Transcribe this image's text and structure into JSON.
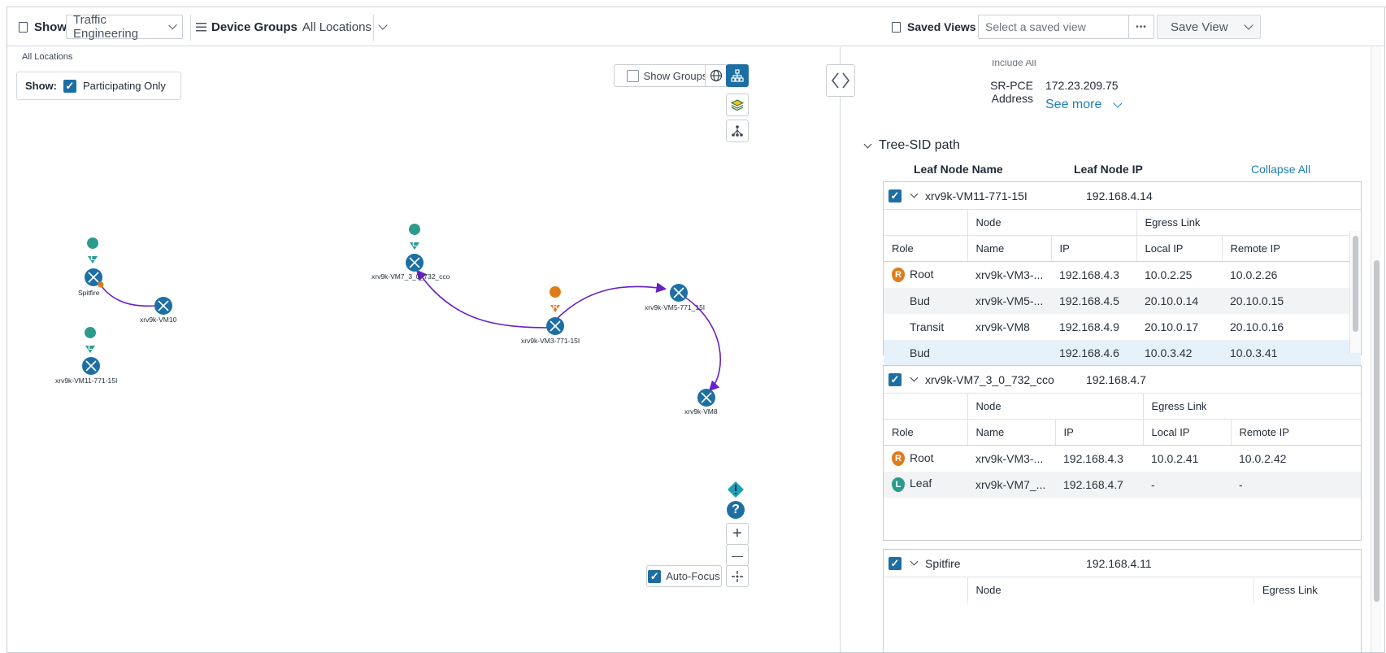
{
  "topbar": {
    "show_label": "Show",
    "show_value": "Traffic Engineering",
    "device_groups_label": "Device Groups",
    "device_groups_value": "All Locations",
    "saved_views_label": "Saved Views",
    "saved_view_placeholder": "Select a saved view",
    "more_label": "•••",
    "save_view_label": "Save View"
  },
  "map": {
    "breadcrumb": "All Locations",
    "show_label": "Show:",
    "participating_label": "Participating Only",
    "show_groups_label": "Show Groups",
    "auto_focus_label": "Auto-Focus",
    "nodes": {
      "spitfire": "Spitfire",
      "vm10": "xrv9k-VM10",
      "vm11": "xrv9k-VM11-771-15I",
      "vm7": "xrv9k-VM7_3_0_732_cco",
      "vm3": "xrv9k-VM3-771-15I",
      "vm5": "xrv9k-VM5-771_15I",
      "vm8": "xrv9k-VM8"
    },
    "badges": {
      "leaf": "L",
      "root": "R"
    },
    "zoom_in": "+",
    "zoom_out": "—",
    "help": "?"
  },
  "details": {
    "cut_text": "Include All",
    "srpce_label": "SR-PCE Address",
    "srpce_value": "172.23.209.75",
    "see_more": "See more",
    "section_title": "Tree-SID path",
    "col_leaf_name": "Leaf Node Name",
    "col_leaf_ip": "Leaf Node IP",
    "collapse_all": "Collapse All",
    "group_node": "Node",
    "group_egress": "Egress Link",
    "col_role": "Role",
    "col_name": "Name",
    "col_ip": "IP",
    "col_local_ip": "Local IP",
    "col_remote_ip": "Remote IP",
    "leaves": [
      {
        "name": "xrv9k-VM11-771-15I",
        "ip": "192.168.4.14",
        "rows": [
          {
            "badge": "R",
            "role": "Root",
            "name": "xrv9k-VM3-...",
            "ip": "192.168.4.3",
            "local": "10.0.2.25",
            "remote": "10.0.2.26"
          },
          {
            "badge": "",
            "role": "Bud",
            "name": "xrv9k-VM5-...",
            "ip": "192.168.4.5",
            "local": "20.10.0.14",
            "remote": "20.10.0.15"
          },
          {
            "badge": "",
            "role": "Transit",
            "name": "xrv9k-VM8",
            "ip": "192.168.4.9",
            "local": "20.10.0.17",
            "remote": "20.10.0.16"
          },
          {
            "badge": "",
            "role": "Bud",
            "name": "",
            "ip": "192.168.4.6",
            "local": "10.0.3.42",
            "remote": "10.0.3.41"
          }
        ]
      },
      {
        "name": "xrv9k-VM7_3_0_732_cco",
        "ip": "192.168.4.7",
        "rows": [
          {
            "badge": "R",
            "role": "Root",
            "name": "xrv9k-VM3-...",
            "ip": "192.168.4.3",
            "local": "10.0.2.41",
            "remote": "10.0.2.42"
          },
          {
            "badge": "L",
            "role": "Leaf",
            "name": "xrv9k-VM7_...",
            "ip": "192.168.4.7",
            "local": "-",
            "remote": "-"
          }
        ]
      },
      {
        "name": "Spitfire",
        "ip": "192.168.4.11",
        "rows": []
      }
    ]
  },
  "colors": {
    "accent": "#1d6fa3",
    "link": "#1d7fb8",
    "path": "#6a1fc9",
    "root": "#e07b1a",
    "leaf": "#2b9c8c"
  }
}
